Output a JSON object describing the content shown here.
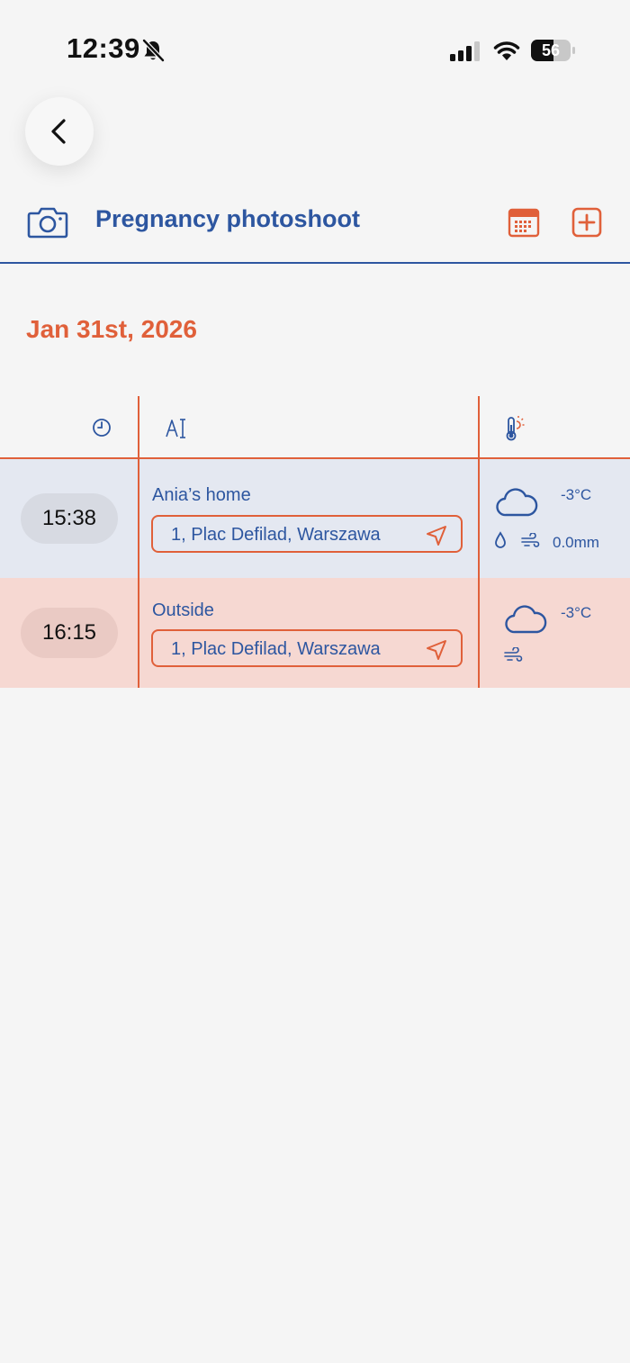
{
  "status_bar": {
    "time": "12:39",
    "battery": "56",
    "battery_level": 0.56
  },
  "header": {
    "title": "Pregnancy photoshoot"
  },
  "date": "Jan 31st, 2026",
  "rows": [
    {
      "time": "15:38",
      "place": "Ania’s home",
      "address": "1, Plac Defilad, Warszawa",
      "temperature": "-3°C",
      "precipitation": "0.0mm"
    },
    {
      "time": "16:15",
      "place": "Outside",
      "address": "1, Plac Defilad, Warszawa",
      "temperature": "-3°C"
    }
  ],
  "colors": {
    "accent_blue": "#2d56a0",
    "accent_orange": "#e0603a",
    "row_blue_bg": "#e4e8f1",
    "row_red_bg": "#f6d8d2",
    "background": "#f5f5f5"
  },
  "icons": [
    "bell-slash-icon",
    "signal-icon",
    "wifi-icon",
    "battery-icon",
    "chevron-left-icon",
    "camera-icon",
    "calendar-icon",
    "add-icon",
    "clock-icon",
    "text-cursor-icon",
    "thermometer-sun-icon",
    "cloud-icon",
    "droplet-icon",
    "wind-icon",
    "navigation-arrow-icon"
  ]
}
